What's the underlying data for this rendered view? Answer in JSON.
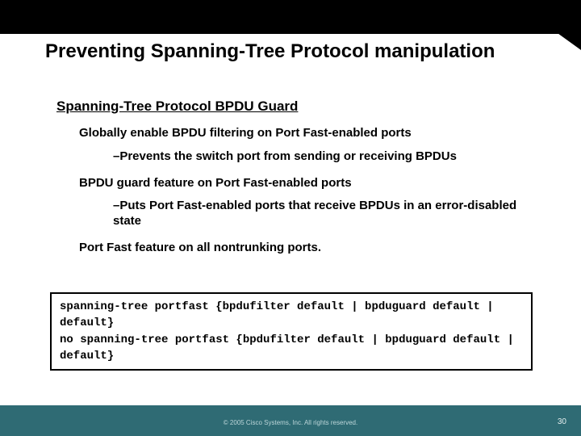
{
  "title": "Preventing Spanning-Tree Protocol manipulation",
  "section_heading": "Spanning-Tree Protocol BPDU Guard",
  "bullets": {
    "b1a": "Globally enable BPDU filtering on Port Fast-enabled ports",
    "b2a": "–Prevents the switch port from sending or receiving BPDUs",
    "b1b": "BPDU guard feature on Port Fast-enabled ports",
    "b2b": "–Puts Port Fast-enabled ports that receive BPDUs in an error-disabled state",
    "b1c": "Port Fast feature on all nontrunking ports."
  },
  "code": "spanning-tree portfast {bpdufilter default | bpduguard default | default}\nno spanning-tree portfast {bpdufilter default | bpduguard default | default}",
  "footer": {
    "copyright": "© 2005 Cisco Systems, Inc. All rights reserved.",
    "page": "30"
  }
}
